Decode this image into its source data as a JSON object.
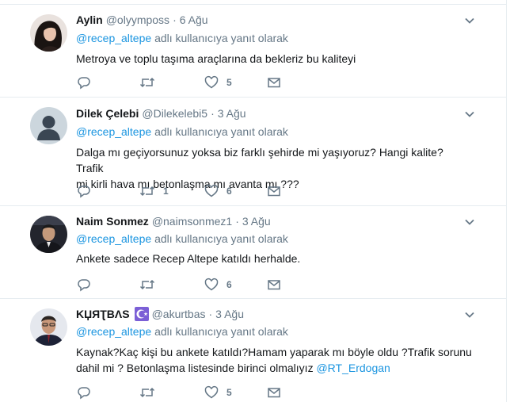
{
  "tweets": [
    {
      "name": "Aylin",
      "handle": "@olyymposs",
      "date": "6 Ağu",
      "reply_mention": "@recep_altepe",
      "reply_suffix": "adlı kullanıcıya yanıt olarak",
      "text_lines": [
        "Metroya ve toplu taşıma araçlarına da bekleriz bu kaliteyi"
      ],
      "retweets": "",
      "likes": "5",
      "avatar_icon": "female-profile-photo"
    },
    {
      "name": "Dilek Çelebi",
      "handle": "@Dilekelebi5",
      "date": "3 Ağu",
      "reply_mention": "@recep_altepe",
      "reply_suffix": "adlı kullanıcıya yanıt olarak",
      "text_lines": [
        "Dalga mı geçiyorsunuz yoksa biz farklı şehirde mi yaşıyoruz? Hangi kalite? Trafik",
        "mi kirli hava mı betonlaşma mı avanta mı ???"
      ],
      "retweets": "1",
      "likes": "6",
      "avatar_icon": "default-profile-silhouette"
    },
    {
      "name": "Naim Sonmez",
      "handle": "@naimsonmez1",
      "date": "3 Ağu",
      "reply_mention": "@recep_altepe",
      "reply_suffix": "adlı kullanıcıya yanıt olarak",
      "text_lines": [
        "Ankete sadece Recep Altepe katıldı herhalde."
      ],
      "retweets": "",
      "likes": "6",
      "avatar_icon": "male-profile-photo"
    },
    {
      "name": "KЏЯƮBΛS",
      "handle": "@akurtbas",
      "date": "3 Ağu",
      "reply_mention": "@recep_altepe",
      "reply_suffix": "adlı kullanıcıya yanıt olarak",
      "text_lines": [
        "Kaynak?Kaç kişi bu ankete katıldı?Hamam yaparak mı böyle oldu ?Trafik sorunu",
        "dahil mi ? Betonlaşma listesinde birinci olmalıyız "
      ],
      "text_mention": "@RT_Erdogan",
      "retweets": "",
      "likes": "5",
      "avatar_icon": "male-profile-photo",
      "name_badge_icon": "crescent-star-icon"
    }
  ],
  "colors": {
    "text": "#14171a",
    "muted": "#657786",
    "link": "#1b95e0",
    "border": "#e6ecf0",
    "badge": "#7b5fd6"
  }
}
